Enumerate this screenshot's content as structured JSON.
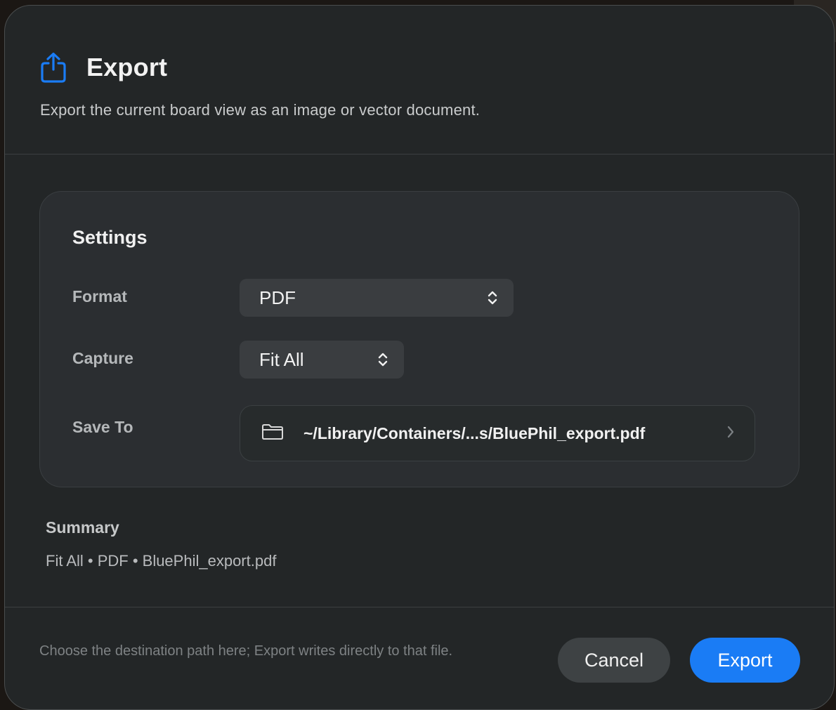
{
  "dialog": {
    "title": "Export",
    "subtitle": "Export the current board view as an image or vector document.",
    "title_icon": "share-icon",
    "accent_color": "#1a7cf5"
  },
  "settings": {
    "title": "Settings",
    "format": {
      "label": "Format",
      "value": "PDF",
      "icon": "updown-chevron-icon"
    },
    "capture": {
      "label": "Capture",
      "value": "Fit All",
      "icon": "updown-chevron-icon"
    },
    "save_to": {
      "label": "Save To",
      "path": "~/Library/Containers/...s/BluePhil_export.pdf",
      "icon": "folder-icon",
      "trailing_icon": "chevron-right-icon"
    }
  },
  "summary": {
    "title": "Summary",
    "text": "Fit All • PDF • BluePhil_export.pdf"
  },
  "footer": {
    "note": "Choose the destination path here; Export writes directly to that file.",
    "cancel_label": "Cancel",
    "export_label": "Export"
  }
}
